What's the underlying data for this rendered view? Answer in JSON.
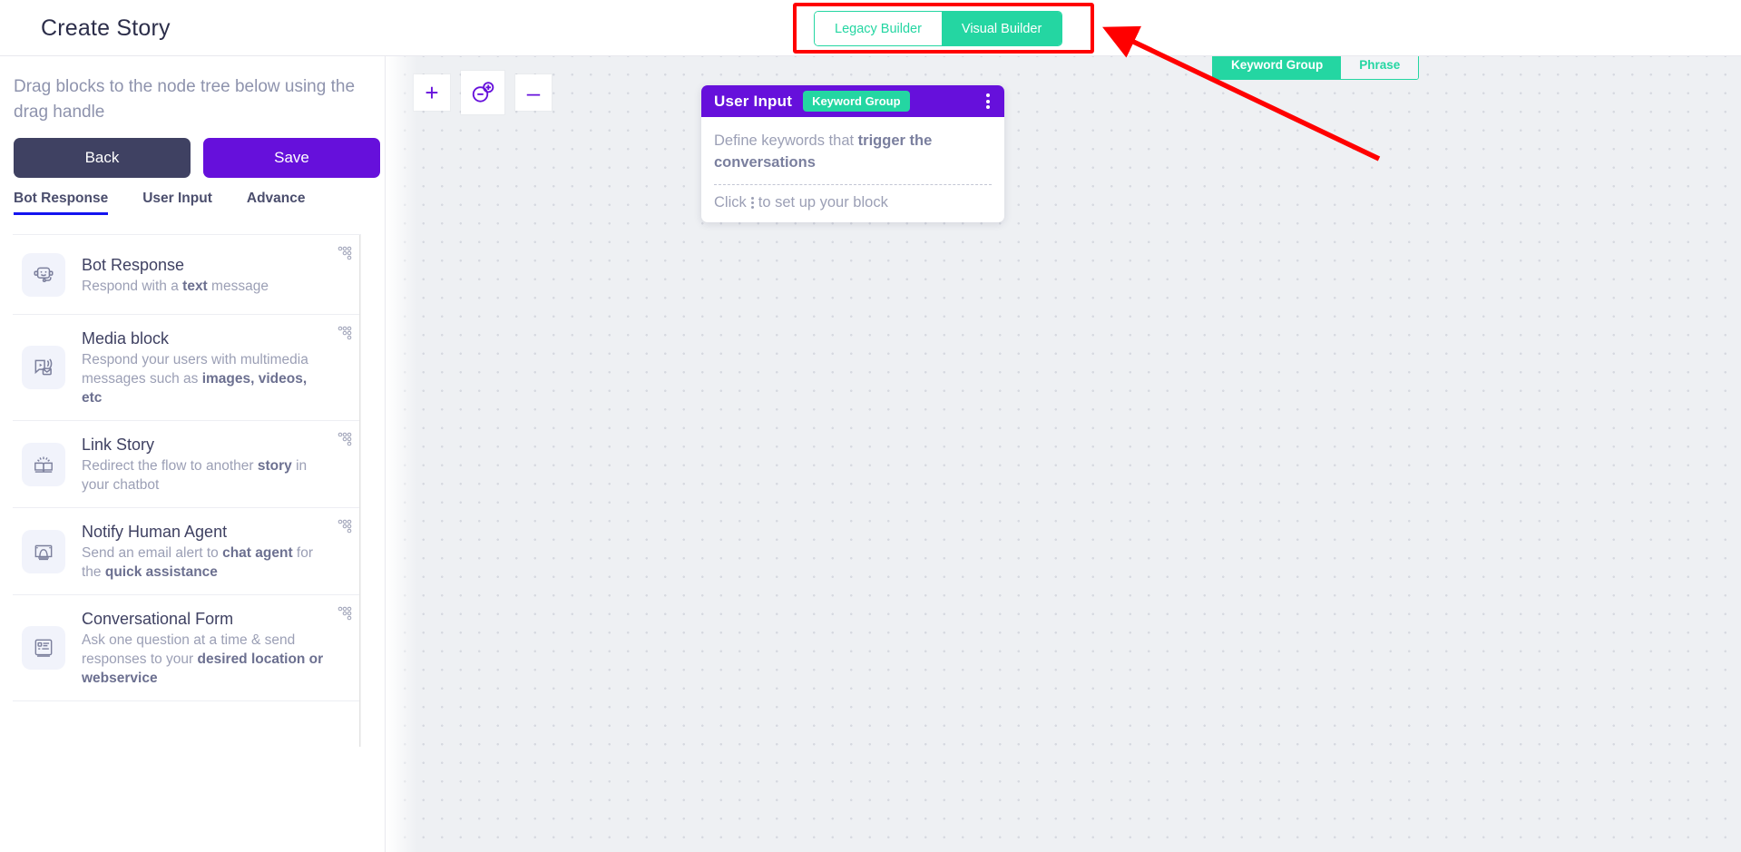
{
  "header": {
    "title": "Create Story",
    "builder_toggle": {
      "options": [
        {
          "label": "Legacy Builder",
          "active": false
        },
        {
          "label": "Visual Builder",
          "active": true
        }
      ],
      "accent_color": "#24d6a2"
    }
  },
  "annotation": {
    "box_color": "#ff0000",
    "arrow_color": "#ff0000"
  },
  "sidebar": {
    "drag_hint": "Drag blocks to the node tree below using the drag handle",
    "buttons": {
      "back": "Back",
      "save": "Save",
      "back_color": "#3f4162",
      "save_color": "#6610db"
    },
    "tabs": [
      {
        "label": "Bot Response",
        "active": true
      },
      {
        "label": "User Input",
        "active": false
      },
      {
        "label": "Advance",
        "active": false
      }
    ],
    "tab_underline_color": "#1414f0",
    "blocks": [
      {
        "title": "Bot Response",
        "desc_html": "Respond with a <b>text</b> message",
        "icon": "bot-face-icon"
      },
      {
        "title": "Media block",
        "desc_html": "Respond your users with multimedia messages such as <b>images, videos, etc</b>",
        "icon": "media-play-mail-icon"
      },
      {
        "title": "Link Story",
        "desc_html": "Redirect the flow to another <b>story</b> in your chatbot",
        "icon": "open-book-icon"
      },
      {
        "title": "Notify Human Agent",
        "desc_html": "Send an email alert to <b>chat agent</b> for the <b>quick assistance</b>",
        "icon": "notification-bell-screen-icon"
      },
      {
        "title": "Conversational Form",
        "desc_html": "Ask one question at a time &amp; send responses to your <b>desired location or webservice</b>",
        "icon": "form-list-icon"
      }
    ],
    "drag_handle_icon": "drag-handle-dots-icon",
    "scrollbar": {
      "up_arrow_icon": "scroll-up-arrow-icon",
      "down_arrow_icon": "scroll-down-arrow-icon"
    }
  },
  "canvas": {
    "zoom_controls": [
      {
        "label": "+",
        "name": "zoom-in-button",
        "icon": "plus-icon"
      },
      {
        "label": "",
        "name": "zoom-reset-button",
        "icon": "zoom-reset-icon"
      },
      {
        "label": "–",
        "name": "zoom-out-button",
        "icon": "minus-icon"
      }
    ],
    "node_tabs": [
      {
        "label": "Keyword Group",
        "active": true
      },
      {
        "label": "Phrase",
        "active": false
      }
    ],
    "node_card": {
      "title": "User Input",
      "badge": "Keyword Group",
      "desc_html": "Define keywords that <b>trigger the conversations</b>",
      "hint_before": "Click",
      "hint_after": "to set up your block",
      "header_color": "#6610db",
      "badge_color": "#24d6a2",
      "menu_icon": "vertical-dots-menu-icon"
    }
  }
}
